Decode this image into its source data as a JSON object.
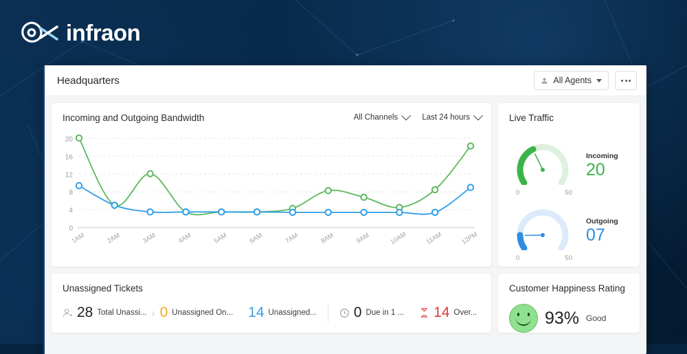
{
  "brand": {
    "name": "infraon",
    "logo_icon": "infraon-eye-logo"
  },
  "window": {
    "title": "Headquarters",
    "agents_filter": {
      "label": "All Agents",
      "icon": "person-icon",
      "caret": "chevron-down-icon"
    },
    "more_button": "more-options-icon"
  },
  "bandwidth": {
    "title": "Incoming and Outgoing Bandwidth",
    "channel_filter": "All Channels",
    "range_filter": "Last 24 hours"
  },
  "live_traffic": {
    "title": "Live Traffic",
    "gauges": [
      {
        "label": "Incoming",
        "value": "20",
        "min": "0",
        "max": "50",
        "color": "#3cb44a",
        "track": "#dff0df",
        "pct": 0.4
      },
      {
        "label": "Outgoing",
        "value": "07",
        "min": "0",
        "max": "50",
        "color": "#2f8ee0",
        "track": "#dceafa",
        "pct": 0.14
      }
    ]
  },
  "tickets": {
    "title": "Unassigned Tickets",
    "items": [
      {
        "icon": "person-add-icon",
        "value": "28",
        "label": "Total Unassi...",
        "color": "#222222"
      },
      {
        "icon": "",
        "value": "0",
        "label": "Unassigned On...",
        "color": "#f5a623"
      },
      {
        "icon": "",
        "value": "14",
        "label": "Unassigned...",
        "color": "#3aa0e8"
      },
      {
        "icon": "clock-icon",
        "value": "0",
        "label": "Due in 1 ...",
        "color": "#222222"
      },
      {
        "icon": "hourglass-icon",
        "value": "14",
        "label": "Over...",
        "color": "#e03b3b"
      }
    ]
  },
  "happiness": {
    "title": "Customer Happiness Rating",
    "icon": "smiley-face-icon",
    "percent": "93%",
    "rating_word": "Good"
  },
  "chart_data": {
    "type": "line",
    "title": "Incoming and Outgoing Bandwidth",
    "xlabel": "",
    "ylabel": "",
    "categories": [
      "1AM",
      "2AM",
      "3AM",
      "4AM",
      "5AM",
      "6AM",
      "7AM",
      "8AM",
      "9AM",
      "10AM",
      "11AM",
      "12PM"
    ],
    "yticks": [
      0,
      4,
      8,
      12,
      16,
      20
    ],
    "ylim": [
      0,
      21
    ],
    "grid": true,
    "legend": "none",
    "series": [
      {
        "name": "Incoming",
        "color": "#5cb85c",
        "values": [
          20.1,
          5.0,
          12.1,
          3.5,
          3.5,
          3.5,
          4.3,
          8.3,
          6.8,
          4.5,
          8.5,
          18.3
        ]
      },
      {
        "name": "Outgoing",
        "color": "#2f9ee8",
        "values": [
          9.4,
          5.0,
          3.5,
          3.5,
          3.5,
          3.5,
          3.4,
          3.4,
          3.4,
          3.4,
          3.4,
          9.0
        ]
      }
    ]
  }
}
